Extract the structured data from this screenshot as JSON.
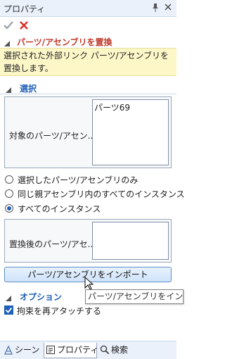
{
  "panel": {
    "title": "プロパティ",
    "pin_icon": "pin-icon",
    "close_icon": "close-icon"
  },
  "actions": {
    "ok_icon": "checkmark-icon",
    "cancel_icon": "cancel-x-icon",
    "ok_color": "#9aa0a6",
    "cancel_color": "#d93025"
  },
  "command": {
    "title": "パーツ/アセンブリを置換",
    "help_text": "選択された外部リンク パーツ/アセンブリを置換します。"
  },
  "selection": {
    "header": "選択",
    "target_label": "対象のパーツ/アセン...",
    "target_items": [
      "パーツ69"
    ],
    "scope_options": [
      {
        "label": "選択したパーツ/アセンブリのみ",
        "selected": false
      },
      {
        "label": "同じ親アセンブリ内のすべてのインスタンス",
        "selected": false
      },
      {
        "label": "すべてのインスタンス",
        "selected": true
      }
    ],
    "replacement_label": "置換後のパーツ/アセ...",
    "import_button": "パーツ/アセンブリをインポート",
    "tooltip": "パーツ/アセンブリをインポ"
  },
  "options": {
    "header": "オプション",
    "reattach_label": "拘束を再アタッチする",
    "reattach_checked": true
  },
  "tabs": [
    {
      "label": "シーン",
      "icon": "scene-icon",
      "active": false
    },
    {
      "label": "プロパティ",
      "icon": "properties-icon",
      "active": true
    },
    {
      "label": "検索",
      "icon": "search-icon",
      "active": false
    }
  ],
  "colors": {
    "accent": "#1f5fb5",
    "command_title": "#c0392b",
    "help_bg": "#fdf7c8"
  }
}
